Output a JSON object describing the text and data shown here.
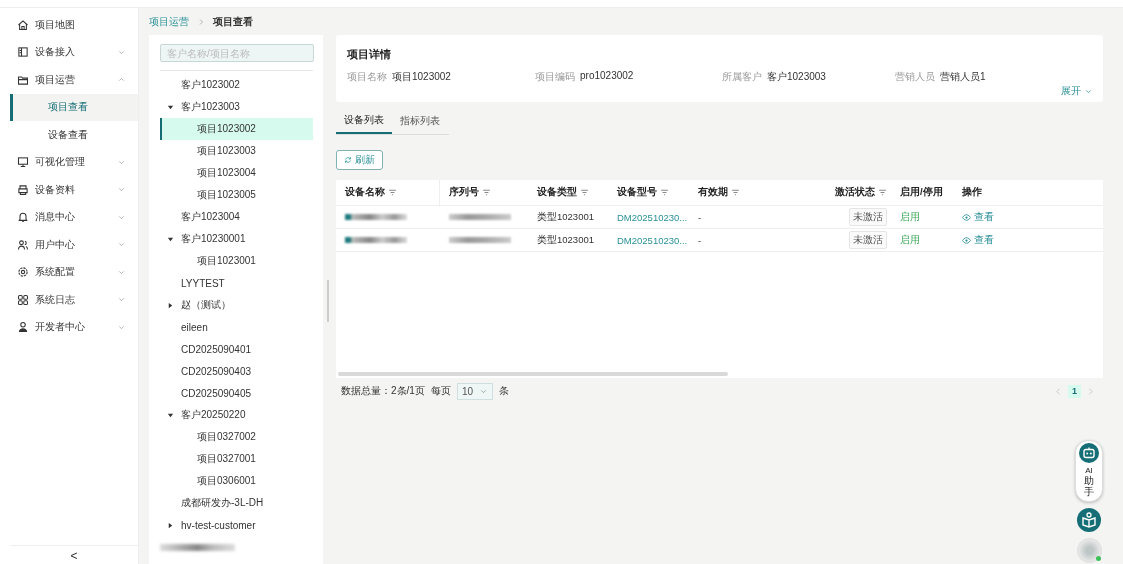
{
  "sidebar": {
    "items": [
      {
        "label": "项目地图",
        "kind": "link",
        "selected": false
      },
      {
        "label": "设备接入",
        "kind": "group",
        "expanded": false,
        "selected": false
      },
      {
        "label": "项目运营",
        "kind": "group",
        "expanded": true,
        "selected": false,
        "children": [
          {
            "label": "项目查看",
            "selected": true
          },
          {
            "label": "设备查看",
            "selected": false
          }
        ]
      },
      {
        "label": "可视化管理",
        "kind": "group",
        "expanded": false,
        "selected": false
      },
      {
        "label": "设备资料",
        "kind": "group",
        "expanded": false,
        "selected": false
      },
      {
        "label": "消息中心",
        "kind": "group",
        "expanded": false,
        "selected": false
      },
      {
        "label": "用户中心",
        "kind": "group",
        "expanded": false,
        "selected": false
      },
      {
        "label": "系统配置",
        "kind": "group",
        "expanded": false,
        "selected": false
      },
      {
        "label": "系统日志",
        "kind": "group",
        "expanded": false,
        "selected": false
      },
      {
        "label": "开发者中心",
        "kind": "group",
        "expanded": false,
        "selected": false
      }
    ],
    "collapse_label": "<"
  },
  "breadcrumb": [
    "项目运营",
    "项目查看"
  ],
  "tree": {
    "search": {
      "placeholder": "客户名称/项目名称"
    },
    "nodes": [
      {
        "label": "客户1023002",
        "selected": false
      },
      {
        "label": "客户1023003",
        "selected": false,
        "expanded": true,
        "children": [
          {
            "label": "项目1023002",
            "selected": true
          },
          {
            "label": "项目1023003",
            "selected": false
          },
          {
            "label": "项目1023004",
            "selected": false
          },
          {
            "label": "项目1023005",
            "selected": false
          }
        ]
      },
      {
        "label": "客户1023004",
        "selected": false
      },
      {
        "label": "客户10230001",
        "selected": false,
        "expanded": true,
        "children": [
          {
            "label": "项目1023001",
            "selected": false
          }
        ]
      },
      {
        "label": "LYYTEST",
        "selected": false
      },
      {
        "label": "赵（测试）",
        "selected": false,
        "expanded": false
      },
      {
        "label": "eileen",
        "selected": false
      },
      {
        "label": "CD2025090401",
        "selected": false
      },
      {
        "label": "CD2025090403",
        "selected": false
      },
      {
        "label": "CD2025090405",
        "selected": false
      },
      {
        "label": "客户20250220",
        "selected": false,
        "expanded": true,
        "children": [
          {
            "label": "项目0327002",
            "selected": false
          },
          {
            "label": "项目0327001",
            "selected": false
          },
          {
            "label": "项目0306001",
            "selected": false
          }
        ]
      },
      {
        "label": "成都研发办-3L-DH",
        "selected": false
      },
      {
        "label": "hv-test-customer",
        "selected": false,
        "expanded": false
      },
      {
        "redacted": true,
        "selected": false
      }
    ]
  },
  "detail": {
    "title": "项目详情",
    "fields": [
      {
        "label": "项目名称",
        "value": "项目1023002"
      },
      {
        "label": "项目编码",
        "value": "pro1023002"
      },
      {
        "label": "所属客户",
        "value": "客户1023003"
      },
      {
        "label": "营销人员",
        "value": "营销人员1"
      }
    ],
    "expand_label": "展开"
  },
  "tabs": [
    {
      "label": "设备列表",
      "selected": true
    },
    {
      "label": "指标列表",
      "selected": false
    }
  ],
  "refresh_button": "刷新",
  "table": {
    "columns": [
      {
        "label": "设备名称",
        "kind": "text",
        "filter": true
      },
      {
        "label": "序列号",
        "kind": "text",
        "filter": true
      },
      {
        "label": "设备类型",
        "kind": "text",
        "filter": true
      },
      {
        "label": "设备型号",
        "kind": "link",
        "filter": true
      },
      {
        "label": "有效期",
        "kind": "text",
        "filter": true
      },
      {
        "label": "激活状态",
        "kind": "tag",
        "filter": true
      },
      {
        "label": "启用/停用",
        "kind": "status",
        "filter": false
      },
      {
        "label": "操作",
        "kind": "action",
        "filter": false
      }
    ],
    "rows": [
      {
        "cells": [
          null,
          null,
          "类型1023001",
          "DM202510230...",
          "-",
          "未激活",
          "启用",
          "查看"
        ]
      },
      {
        "cells": [
          null,
          null,
          "类型1023001",
          "DM202510230...",
          "-",
          "未激活",
          "启用",
          "查看"
        ]
      }
    ]
  },
  "pagination": {
    "summary": "数据总量：2条/1页",
    "per_page_label": "每页",
    "per_page": "10",
    "unit": "条",
    "pages": [
      {
        "label": "1",
        "selected": true
      }
    ]
  },
  "assistant": {
    "ai": "AI",
    "label": "助手"
  }
}
